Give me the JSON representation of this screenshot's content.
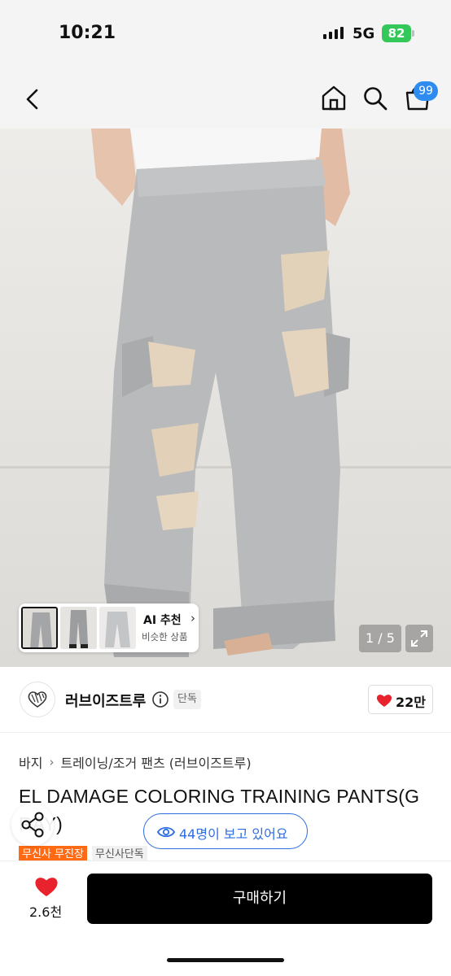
{
  "status_bar": {
    "time": "10:21",
    "network": "5G",
    "battery": "82"
  },
  "header": {
    "cart_count": "99"
  },
  "gallery": {
    "current_page": "1 / 5",
    "ai_recommend": {
      "title": "AI 추천",
      "subtitle": "비슷한 상품"
    }
  },
  "brand": {
    "name": "러브이즈트루",
    "badge": "단독",
    "like_count": "22만"
  },
  "breadcrumb": [
    "바지",
    "트레이닝/조거 팬츠 (러브이즈트루)"
  ],
  "product": {
    "title": "EL DAMAGE COLORING TRAINING PANTS(G RAY)",
    "badges": [
      "무신사 무진장",
      "무신사단독"
    ]
  },
  "viewers_text": "44명이 보고 있어요",
  "bottom_bar": {
    "wish_count": "2.6천",
    "buy_label": "구매하기"
  },
  "colors": {
    "accent_blue": "#2e6de0",
    "badge_blue": "#2e8cf0",
    "heart_red": "#e8232d",
    "badge_orange": "#ff6a13"
  }
}
